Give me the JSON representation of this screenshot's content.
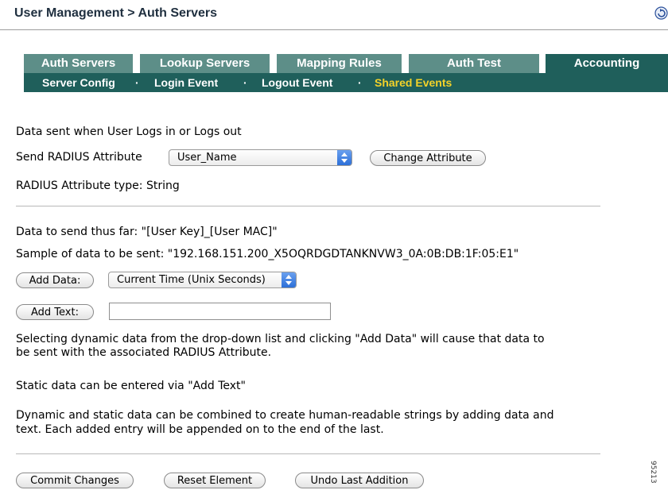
{
  "header": {
    "title": "User Management > Auth Servers",
    "refresh_icon": "refresh-icon"
  },
  "tabs": [
    {
      "label": "Auth Servers",
      "active": false
    },
    {
      "label": "Lookup Servers",
      "active": false
    },
    {
      "label": "Mapping Rules",
      "active": false
    },
    {
      "label": "Auth Test",
      "active": false
    },
    {
      "label": "Accounting",
      "active": true
    }
  ],
  "subnav": {
    "items": [
      "Server Config",
      "Login Event",
      "Logout Event",
      "Shared Events"
    ],
    "separator": "·",
    "current": "Shared Events"
  },
  "section1": {
    "description": "Data sent when User Logs in or Logs out",
    "send_attr_label": "Send RADIUS Attribute",
    "send_attr_value": "User_Name",
    "change_attr_button": "Change Attribute",
    "attr_type_text": "RADIUS Attribute type: String"
  },
  "section2": {
    "data_thus_far": "Data to send thus far: \"[User Key]_[User MAC]\"",
    "sample": "Sample of data to be sent: \"192.168.151.200_X5OQRDGDTANKNVW3_0A:0B:DB:1F:05:E1\"",
    "add_data_button": "Add Data:",
    "add_data_select_value": "Current Time (Unix Seconds)",
    "add_text_button": "Add Text:",
    "add_text_value": "",
    "help1_line1": "Selecting dynamic data from the drop-down list and clicking \"Add Data\" will cause that data to",
    "help1_line2": "be sent with the associated RADIUS Attribute.",
    "help2": "Static data can be entered via \"Add Text\"",
    "help3_line1": "Dynamic and static data can be combined to create human-readable strings by adding data and",
    "help3_line2": "text. Each added entry will be appended on to the end of the last."
  },
  "footer": {
    "commit_button": "Commit Changes",
    "reset_button": "Reset Element",
    "undo_button": "Undo Last Addition",
    "side_code": "95213"
  },
  "colors": {
    "tab_inactive": "#5d8e88",
    "tab_active": "#1f5f5b",
    "subnav_current": "#f3d229"
  }
}
